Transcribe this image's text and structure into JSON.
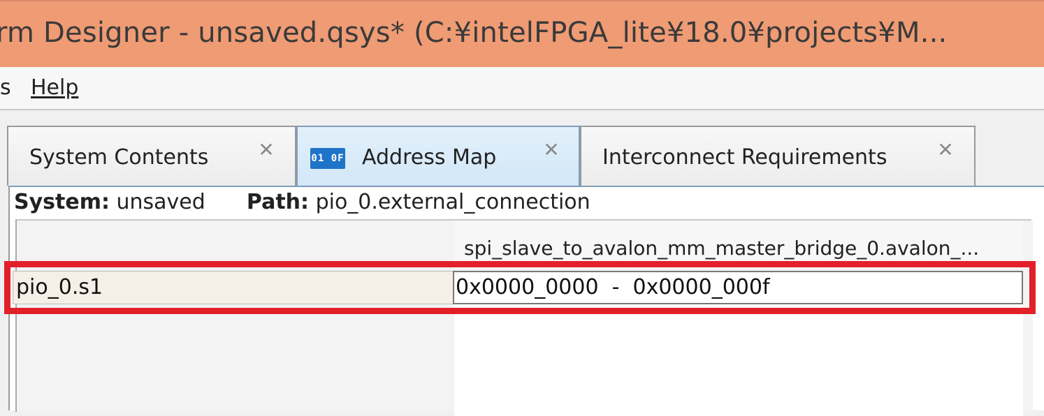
{
  "window": {
    "title": "rm Designer - unsaved.qsys* (C:¥intelFPGA_lite¥18.0¥projects¥M..."
  },
  "menu": {
    "items": [
      {
        "label": "s"
      },
      {
        "label": "Help"
      }
    ]
  },
  "tabs": [
    {
      "label": "System Contents",
      "active": false
    },
    {
      "label": "Address Map",
      "active": true,
      "icon": "address-map-icon",
      "icon_text": "01 0F"
    },
    {
      "label": "Interconnect Requirements",
      "active": false
    }
  ],
  "close_glyph": "✕",
  "path_bar": {
    "system_label": "System:",
    "system_value": "unsaved",
    "path_label": "Path:",
    "path_value": "pio_0.external_connection"
  },
  "address_table": {
    "column_header": "spi_slave_to_avalon_mm_master_bridge_0.avalon_...",
    "rows": [
      {
        "slave": "pio_0.s1",
        "range": "0x0000_0000  -  0x0000_000f"
      }
    ]
  },
  "colors": {
    "titlebar": "#ef9b74",
    "highlight": "#e2202a",
    "active_tab": "#d3e7f7"
  }
}
